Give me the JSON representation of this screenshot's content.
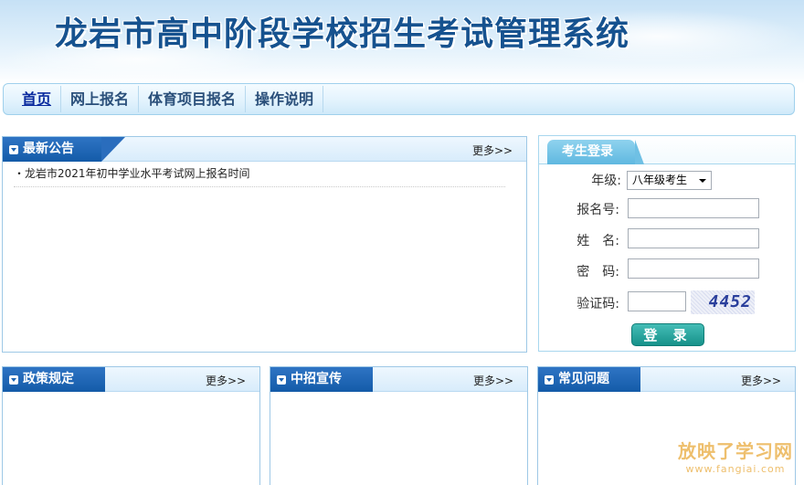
{
  "header": {
    "title": "龙岩市高中阶段学校招生考试管理系统"
  },
  "nav": {
    "items": [
      {
        "label": "首页",
        "active": true
      },
      {
        "label": "网上报名"
      },
      {
        "label": "体育项目报名"
      },
      {
        "label": "操作说明"
      }
    ]
  },
  "announcements": {
    "title": "最新公告",
    "more": "更多>>",
    "items": [
      "・龙岩市2021年初中学业水平考试网上报名时间"
    ]
  },
  "login": {
    "title": "考生登录",
    "grade_label": "年级:",
    "grade_value": "八年级考生",
    "regno_label": "报名号:",
    "name_label": "姓　名:",
    "password_label": "密　码:",
    "captcha_label": "验证码:",
    "captcha_text": "4452",
    "submit": "登 录"
  },
  "sections": {
    "policy": {
      "title": "政策规定",
      "more": "更多>>"
    },
    "publicity": {
      "title": "中招宣传",
      "more": "更多>>"
    },
    "faq": {
      "title": "常见问题",
      "more": "更多>>"
    }
  },
  "watermark": {
    "main": "放映了学习网",
    "sub": "www.fangiai.com"
  },
  "colors": {
    "title_blue": "#16528f",
    "tab_blue": "#145ba8",
    "login_tab": "#5fb8e0",
    "button_teal": "#16918a"
  }
}
